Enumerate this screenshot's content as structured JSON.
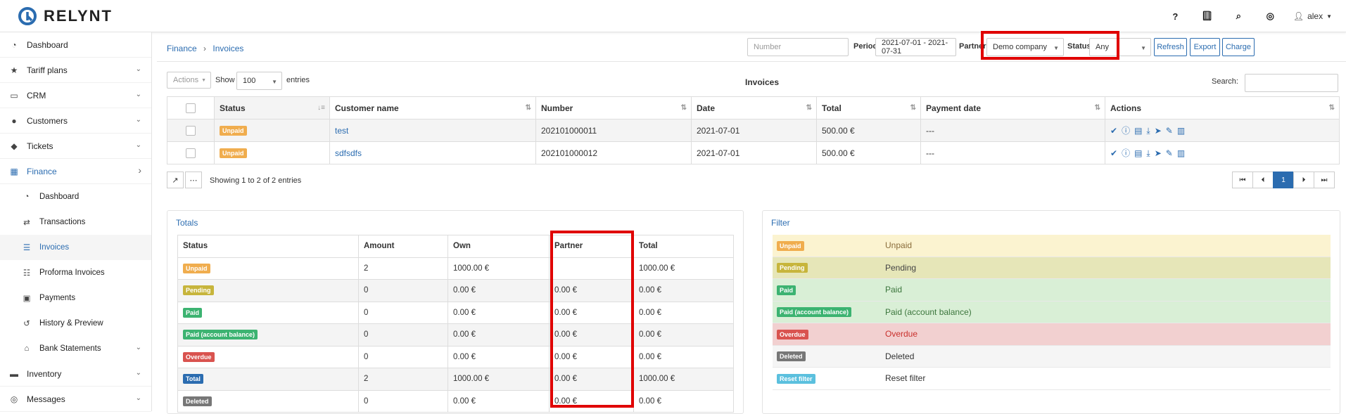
{
  "app": {
    "brand": "RELYNT"
  },
  "topbar": {
    "help": "?",
    "user": "alex"
  },
  "sidebar": {
    "items": [
      {
        "label": "Dashboard",
        "icon": "tachometer-icon",
        "chevron": ""
      },
      {
        "label": "Tariff plans",
        "icon": "star-icon",
        "chevron": "⌄"
      },
      {
        "label": "CRM",
        "icon": "monitor-icon",
        "chevron": "⌄"
      },
      {
        "label": "Customers",
        "icon": "user-icon",
        "chevron": "⌄"
      },
      {
        "label": "Tickets",
        "icon": "tag-icon",
        "chevron": "⌄"
      },
      {
        "label": "Finance",
        "icon": "calculator-icon",
        "chevron": "›"
      }
    ],
    "finance_sub": [
      {
        "label": "Dashboard",
        "icon": "tachometer-icon"
      },
      {
        "label": "Transactions",
        "icon": "arrows-icon"
      },
      {
        "label": "Invoices",
        "icon": "list-icon"
      },
      {
        "label": "Proforma Invoices",
        "icon": "list-alt-icon"
      },
      {
        "label": "Payments",
        "icon": "wallet-icon"
      },
      {
        "label": "History & Preview",
        "icon": "history-icon"
      },
      {
        "label": "Bank Statements",
        "icon": "bank-icon"
      }
    ],
    "items_after": [
      {
        "label": "Inventory",
        "icon": "folder-icon"
      },
      {
        "label": "Messages",
        "icon": "globe-icon"
      }
    ]
  },
  "header": {
    "breadcrumb": [
      "Finance",
      "Invoices"
    ],
    "number_placeholder": "Number",
    "period_label": "Period",
    "period_value": "2021-07-01 - 2021-07-31",
    "partner_label": "Partner",
    "partner_value": "Demo company",
    "status_label": "Status",
    "status_value": "Any",
    "refresh": "Refresh",
    "export": "Export",
    "charge": "Charge"
  },
  "invoices": {
    "actions_label": "Actions",
    "show_label": "Show",
    "show_value": "100",
    "entries_label": "entries",
    "title": "Invoices",
    "search_label": "Search:",
    "columns": [
      "Status",
      "Customer name",
      "Number",
      "Date",
      "Total",
      "Payment date",
      "Actions"
    ],
    "rows": [
      {
        "status": "Unpaid",
        "customer": "test",
        "number": "202101000011",
        "date": "2021-07-01",
        "total": "500.00 €",
        "payment_date": "---"
      },
      {
        "status": "Unpaid",
        "customer": "sdfsdfs",
        "number": "202101000012",
        "date": "2021-07-01",
        "total": "500.00 €",
        "payment_date": "---"
      }
    ],
    "showing": "Showing 1 to 2 of 2 entries",
    "current_page": "1"
  },
  "totals": {
    "title": "Totals",
    "columns": [
      "Status",
      "Amount",
      "Own",
      "Partner",
      "Total"
    ],
    "rows": [
      {
        "status": "Unpaid",
        "amount": "2",
        "own": "1000.00 €",
        "partner": "",
        "total": "1000.00 €"
      },
      {
        "status": "Pending",
        "amount": "0",
        "own": "0.00 €",
        "partner": "0.00 €",
        "total": "0.00 €"
      },
      {
        "status": "Paid",
        "amount": "0",
        "own": "0.00 €",
        "partner": "0.00 €",
        "total": "0.00 €"
      },
      {
        "status": "Paid (account balance)",
        "amount": "0",
        "own": "0.00 €",
        "partner": "0.00 €",
        "total": "0.00 €"
      },
      {
        "status": "Overdue",
        "amount": "0",
        "own": "0.00 €",
        "partner": "0.00 €",
        "total": "0.00 €"
      },
      {
        "status": "Total",
        "amount": "2",
        "own": "1000.00 €",
        "partner": "0.00 €",
        "total": "1000.00 €"
      },
      {
        "status": "Deleted",
        "amount": "0",
        "own": "0.00 €",
        "partner": "0.00 €",
        "total": "0.00 €"
      }
    ]
  },
  "filter": {
    "title": "Filter",
    "rows": [
      {
        "badge": "Unpaid",
        "label": "Unpaid",
        "color": "#fbf3d0"
      },
      {
        "badge": "Pending",
        "label": "Pending",
        "color": "#e6e6b8"
      },
      {
        "badge": "Paid",
        "label": "Paid",
        "color": "#d9efd6"
      },
      {
        "badge": "Paid (account balance)",
        "label": "Paid (account balance)",
        "color": "#d9efd6"
      },
      {
        "badge": "Overdue",
        "label": "Overdue",
        "color": "#f2d0d0"
      },
      {
        "badge": "Deleted",
        "label": "Deleted",
        "color": "#f5f5f5"
      },
      {
        "badge": "Reset filter",
        "label": "Reset filter",
        "color": "#ffffff"
      }
    ]
  },
  "colors": {
    "accent": "#2b6cb0",
    "highlight": "#e00000"
  }
}
